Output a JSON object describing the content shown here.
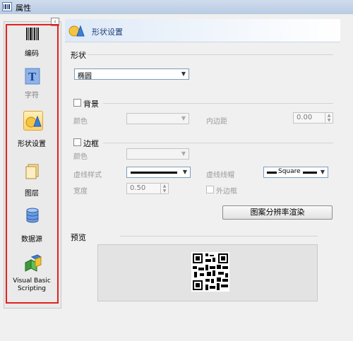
{
  "window": {
    "title": "属性"
  },
  "sidebar": {
    "items": [
      {
        "label": "编码",
        "icon": "barcode-icon"
      },
      {
        "label": "字符",
        "icon": "text-icon"
      },
      {
        "label": "形状设置",
        "icon": "shape-settings-icon"
      },
      {
        "label": "图层",
        "icon": "layers-icon"
      },
      {
        "label": "数据源",
        "icon": "database-icon"
      },
      {
        "label": "Visual Basic Scripting",
        "icon": "vbscript-icon"
      }
    ],
    "active_index": 2,
    "highlight_color": "#e32020"
  },
  "header": {
    "title": "形状设置",
    "icon": "shape-settings-icon"
  },
  "shape": {
    "group_label": "形状",
    "value": "椭圆"
  },
  "background": {
    "label": "背景",
    "checked": false,
    "color_label": "颜色",
    "padding_label": "内边距",
    "padding_value": "0.00"
  },
  "border": {
    "label": "边框",
    "checked": false,
    "color_label": "颜色",
    "dash_style_label": "虚线样式",
    "dash_cap_label": "虚线线帽",
    "dash_cap_value": "Square",
    "width_label": "宽度",
    "width_value": "0.50",
    "outer_border_label": "外边框",
    "outer_border_checked": false
  },
  "render_button": {
    "label": "图案分辨率渲染"
  },
  "preview": {
    "label": "预览"
  },
  "colors": {
    "accent": "#1f3d7a",
    "header_bg": "#dde9f7"
  }
}
